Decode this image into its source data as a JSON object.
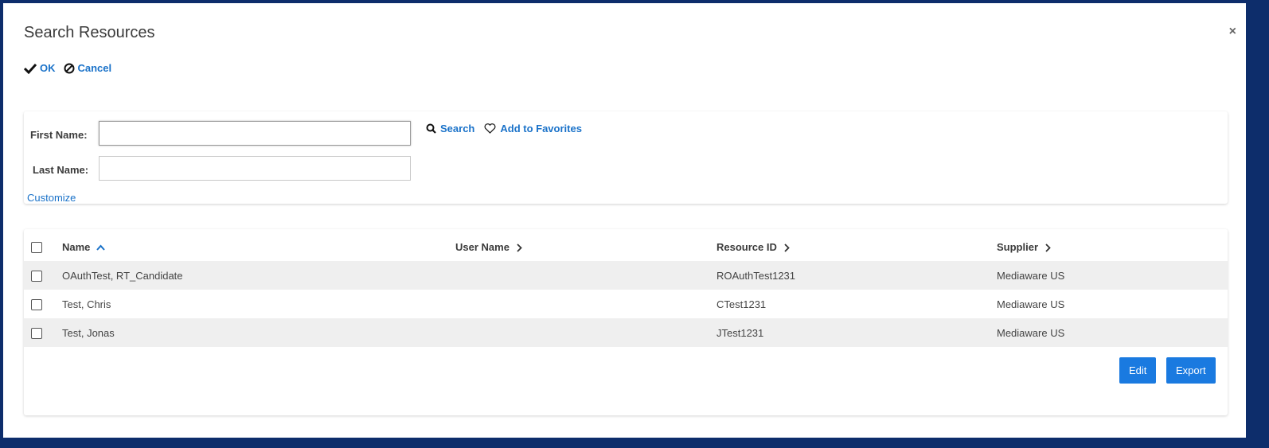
{
  "dialog": {
    "title": "Search Resources",
    "close_glyph": "×"
  },
  "toolbar": {
    "ok_label": "OK",
    "cancel_label": "Cancel"
  },
  "search": {
    "first_name_label": "First Name:",
    "first_name_value": "",
    "last_name_label": "Last Name:",
    "last_name_value": "",
    "search_label": "Search",
    "favorites_label": "Add to Favorites",
    "customize_label": "Customize"
  },
  "table": {
    "columns": [
      "Name",
      "User Name",
      "Resource ID",
      "Supplier"
    ],
    "rows": [
      {
        "name": "OAuthTest, RT_Candidate",
        "user_name": "",
        "resource_id": "ROAuthTest1231",
        "supplier": "Mediaware US"
      },
      {
        "name": "Test, Chris",
        "user_name": "",
        "resource_id": "CTest1231",
        "supplier": "Mediaware US"
      },
      {
        "name": "Test, Jonas",
        "user_name": "",
        "resource_id": "JTest1231",
        "supplier": "Mediaware US"
      }
    ]
  },
  "actions": {
    "edit_label": "Edit",
    "export_label": "Export"
  },
  "colors": {
    "link": "#1a72c9",
    "primary_button": "#1a7ae0",
    "frame": "#0d2d6b",
    "row_alt": "#efefef"
  }
}
